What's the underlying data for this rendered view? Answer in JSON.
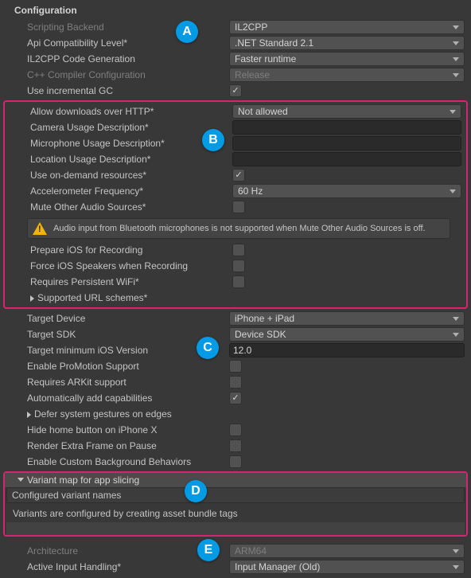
{
  "header": "Configuration",
  "badges": {
    "a": "A",
    "b": "B",
    "c": "C",
    "d": "D",
    "e": "E"
  },
  "rows": {
    "scriptingBackend": {
      "label": "Scripting Backend",
      "value": "IL2CPP"
    },
    "apiCompat": {
      "label": "Api Compatibility Level*",
      "value": ".NET Standard 2.1"
    },
    "il2cppGen": {
      "label": "IL2CPP Code Generation",
      "value": "Faster runtime"
    },
    "cppCompiler": {
      "label": "C++ Compiler Configuration",
      "value": "Release"
    },
    "incrementalGC": {
      "label": "Use incremental GC"
    },
    "allowHTTP": {
      "label": "Allow downloads over HTTP*",
      "value": "Not allowed"
    },
    "cameraDesc": {
      "label": "Camera Usage Description*"
    },
    "micDesc": {
      "label": "Microphone Usage Description*"
    },
    "locDesc": {
      "label": "Location Usage Description*"
    },
    "onDemand": {
      "label": "Use on-demand resources*"
    },
    "accelFreq": {
      "label": "Accelerometer Frequency*",
      "value": "60 Hz"
    },
    "muteOther": {
      "label": "Mute Other Audio Sources*"
    },
    "warning": "Audio input from Bluetooth microphones is not supported when Mute Other Audio Sources is off.",
    "prepareRec": {
      "label": "Prepare iOS for Recording"
    },
    "forceSpeakers": {
      "label": "Force iOS Speakers when Recording"
    },
    "persistWifi": {
      "label": "Requires Persistent WiFi*"
    },
    "urlSchemes": {
      "label": "Supported URL schemes*"
    },
    "targetDevice": {
      "label": "Target Device",
      "value": "iPhone + iPad"
    },
    "targetSDK": {
      "label": "Target SDK",
      "value": "Device SDK"
    },
    "minIOS": {
      "label": "Target minimum iOS Version",
      "value": "12.0"
    },
    "proMotion": {
      "label": "Enable ProMotion Support"
    },
    "arkit": {
      "label": "Requires ARKit support"
    },
    "autoCap": {
      "label": "Automatically add capabilities"
    },
    "deferGestures": {
      "label": "Defer system gestures on edges"
    },
    "hideHome": {
      "label": "Hide home button on iPhone X"
    },
    "extraFrame": {
      "label": "Render Extra Frame on Pause"
    },
    "customBg": {
      "label": "Enable Custom Background Behaviors"
    },
    "variantHeader": "Variant map for app slicing",
    "variantConfigured": "Configured variant names",
    "variantMsg": "Variants are configured by creating asset bundle tags",
    "architecture": {
      "label": "Architecture",
      "value": "ARM64"
    },
    "inputHandling": {
      "label": "Active Input Handling*",
      "value": "Input Manager (Old)"
    }
  }
}
